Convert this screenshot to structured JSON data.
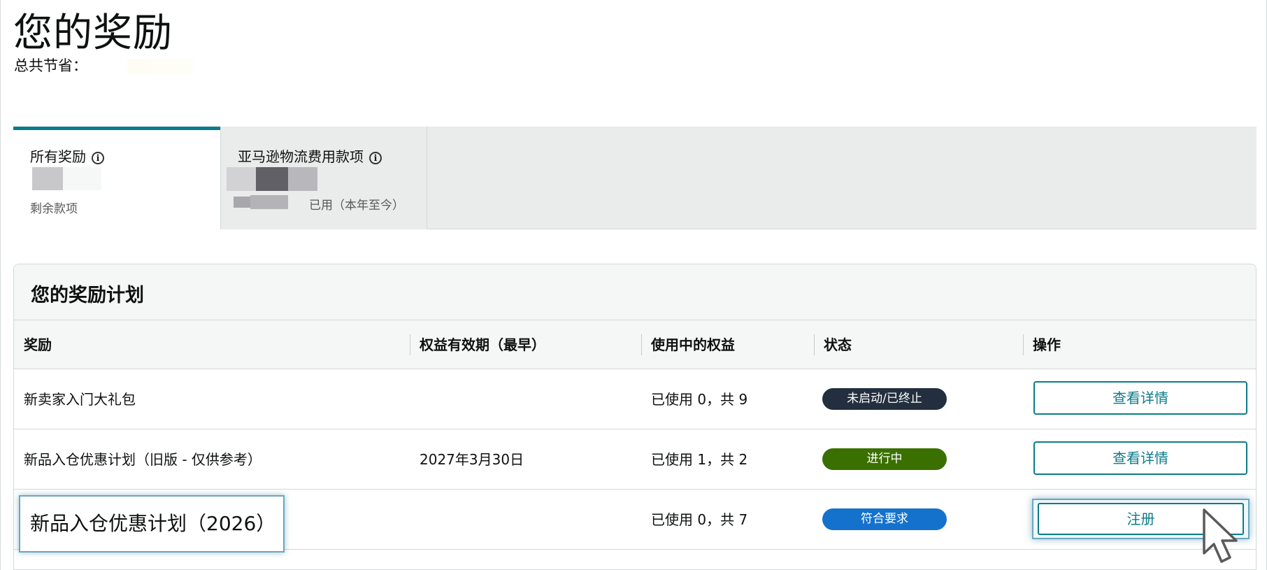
{
  "header": {
    "title": "您的奖励",
    "savings_label": "总共节省："
  },
  "tabs": [
    {
      "label": "所有奖励",
      "sub_label": "剩余款项"
    },
    {
      "label": "亚马逊物流费用款项",
      "sub_label": "已用（本年至今）"
    }
  ],
  "card": {
    "title": "您的奖励计划",
    "columns": [
      "奖励",
      "权益有效期（最早）",
      "使用中的权益",
      "状态",
      "操作"
    ],
    "rows": [
      {
        "name": "新卖家入门大礼包",
        "expiry": "",
        "usage": "已使用 0，共 9",
        "status": "未启动/已终止",
        "action": "查看详情"
      },
      {
        "name": "新品入仓优惠计划（旧版 - 仅供参考）",
        "expiry": "2027年3月30日",
        "usage": "已使用 1，共 2",
        "status": "进行中",
        "action": "查看详情"
      },
      {
        "name": "新品入仓优惠计划（2026）",
        "expiry": "",
        "usage": "已使用 0，共 7",
        "status": "符合要求",
        "action": "注册"
      }
    ]
  },
  "colors": {
    "accent": "#0b7b8a",
    "status_inactive": "#232f3e",
    "status_active": "#3a7000",
    "status_eligible": "#1572cc"
  },
  "icons": [
    "info-icon",
    "cursor-pointer-icon"
  ]
}
